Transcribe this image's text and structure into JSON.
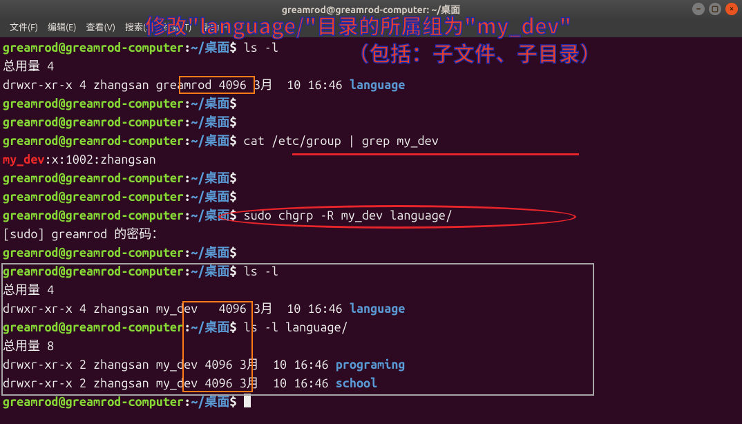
{
  "window": {
    "title": "greamrod@greamrod-computer: ~/桌面"
  },
  "menu": {
    "file": "文件(F)",
    "edit": "编辑(E)",
    "view": "查看(V)",
    "search": "搜索(S)",
    "terminal": "终端(T)",
    "help": "帮助(H)"
  },
  "prompt": {
    "user": "greamrod@greamrod-computer",
    "colon": ":",
    "tilde": "~/",
    "path_cn": "桌面",
    "dollar": "$"
  },
  "lines": [
    {
      "type": "prompt",
      "cmd": " ls -l"
    },
    {
      "type": "plain",
      "text": "总用量 4"
    },
    {
      "type": "ls",
      "perm": "drwxr-xr-x 4 zhangsan ",
      "grp": "greamrod",
      "rest": " 4096 3月  10 16:46 ",
      "dir": "language"
    },
    {
      "type": "prompt",
      "cmd": ""
    },
    {
      "type": "prompt",
      "cmd": ""
    },
    {
      "type": "prompt",
      "cmd": " cat /etc/group | grep my_dev"
    },
    {
      "type": "grep",
      "match": "my_dev",
      "rest": ":x:1002:zhangsan"
    },
    {
      "type": "prompt",
      "cmd": ""
    },
    {
      "type": "prompt",
      "cmd": ""
    },
    {
      "type": "prompt",
      "cmd": " sudo chgrp -R my_dev language/"
    },
    {
      "type": "plain",
      "text": "[sudo] greamrod 的密码："
    },
    {
      "type": "prompt",
      "cmd": ""
    },
    {
      "type": "prompt",
      "cmd": " ls -l"
    },
    {
      "type": "plain",
      "text": "总用量 4"
    },
    {
      "type": "ls",
      "perm": "drwxr-xr-x 4 zhangsan ",
      "grp": "my_dev  ",
      "rest": " 4096 3月  10 16:46 ",
      "dir": "language"
    },
    {
      "type": "prompt",
      "cmd": " ls -l language/"
    },
    {
      "type": "plain",
      "text": "总用量 8"
    },
    {
      "type": "ls",
      "perm": "drwxr-xr-x 2 zhangsan ",
      "grp": "my_dev",
      "rest": " 4096 3月  10 16:46 ",
      "dir": "programing"
    },
    {
      "type": "ls",
      "perm": "drwxr-xr-x 2 zhangsan ",
      "grp": "my_dev",
      "rest": " 4096 3月  10 16:46 ",
      "dir": "school"
    },
    {
      "type": "promptcursor",
      "cmd": " "
    }
  ],
  "annotations": {
    "line1": "修改\"language/\"目录的所属组为\"my_dev\"",
    "line2": "（包括：子文件、子目录）"
  }
}
